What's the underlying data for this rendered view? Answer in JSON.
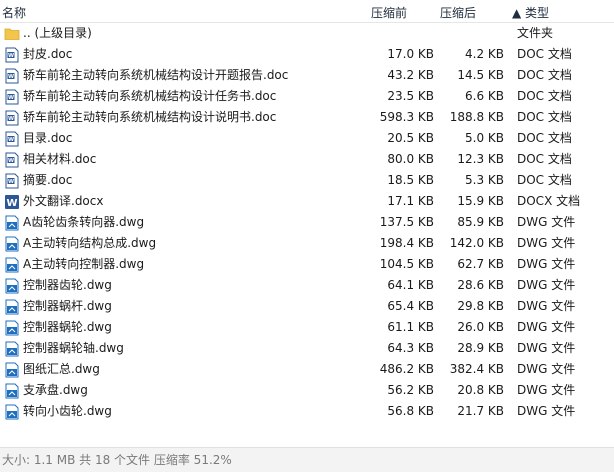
{
  "header": {
    "name": "名称",
    "compressed": "压缩前",
    "original": "压缩后",
    "type": "▲ 类型"
  },
  "files": [
    {
      "name": ".. (上级目录)",
      "compressed": "",
      "original": "",
      "type": "文件夹",
      "icon": "folder-icon"
    },
    {
      "name": "封皮.doc",
      "compressed": "17.0 KB",
      "original": "4.2 KB",
      "type": "DOC 文档",
      "icon": "word-doc-icon"
    },
    {
      "name": "轿车前轮主动转向系统机械结构设计开题报告.doc",
      "compressed": "43.2 KB",
      "original": "14.5 KB",
      "type": "DOC 文档",
      "icon": "word-doc-icon"
    },
    {
      "name": "轿车前轮主动转向系统机械结构设计任务书.doc",
      "compressed": "23.5 KB",
      "original": "6.6 KB",
      "type": "DOC 文档",
      "icon": "word-doc-icon"
    },
    {
      "name": "轿车前轮主动转向系统机械结构设计说明书.doc",
      "compressed": "598.3 KB",
      "original": "188.8 KB",
      "type": "DOC 文档",
      "icon": "word-doc-icon"
    },
    {
      "name": "目录.doc",
      "compressed": "20.5 KB",
      "original": "5.0 KB",
      "type": "DOC 文档",
      "icon": "word-doc-icon"
    },
    {
      "name": "相关材料.doc",
      "compressed": "80.0 KB",
      "original": "12.3 KB",
      "type": "DOC 文档",
      "icon": "word-doc-icon"
    },
    {
      "name": "摘要.doc",
      "compressed": "18.5 KB",
      "original": "5.3 KB",
      "type": "DOC 文档",
      "icon": "word-doc-icon"
    },
    {
      "name": "外文翻译.docx",
      "compressed": "17.1 KB",
      "original": "15.9 KB",
      "type": "DOCX 文档",
      "icon": "word-docx-icon"
    },
    {
      "name": "A齿轮齿条转向器.dwg",
      "compressed": "137.5 KB",
      "original": "85.9 KB",
      "type": "DWG 文件",
      "icon": "dwg-file-icon"
    },
    {
      "name": "A主动转向结构总成.dwg",
      "compressed": "198.4 KB",
      "original": "142.0 KB",
      "type": "DWG 文件",
      "icon": "dwg-file-icon"
    },
    {
      "name": "A主动转向控制器.dwg",
      "compressed": "104.5 KB",
      "original": "62.7 KB",
      "type": "DWG 文件",
      "icon": "dwg-file-icon"
    },
    {
      "name": "控制器齿轮.dwg",
      "compressed": "64.1 KB",
      "original": "28.6 KB",
      "type": "DWG 文件",
      "icon": "dwg-file-icon"
    },
    {
      "name": "控制器蜗杆.dwg",
      "compressed": "65.4 KB",
      "original": "29.8 KB",
      "type": "DWG 文件",
      "icon": "dwg-file-icon"
    },
    {
      "name": "控制器蜗轮.dwg",
      "compressed": "61.1 KB",
      "original": "26.0 KB",
      "type": "DWG 文件",
      "icon": "dwg-file-icon"
    },
    {
      "name": "控制器蜗轮轴.dwg",
      "compressed": "64.3 KB",
      "original": "28.9 KB",
      "type": "DWG 文件",
      "icon": "dwg-file-icon"
    },
    {
      "name": "图纸汇总.dwg",
      "compressed": "486.2 KB",
      "original": "382.4 KB",
      "type": "DWG 文件",
      "icon": "dwg-file-icon"
    },
    {
      "name": "支承盘.dwg",
      "compressed": "56.2 KB",
      "original": "20.8 KB",
      "type": "DWG 文件",
      "icon": "dwg-file-icon"
    },
    {
      "name": "转向小齿轮.dwg",
      "compressed": "56.8 KB",
      "original": "21.7 KB",
      "type": "DWG 文件",
      "icon": "dwg-file-icon"
    }
  ],
  "status": {
    "text": "大小: 1.1 MB 共 18 个文件 压缩率 51.2%"
  },
  "colors": {
    "folder": "#f3c54d",
    "word": "#2b5797",
    "dwg": "#1f6fbf"
  }
}
